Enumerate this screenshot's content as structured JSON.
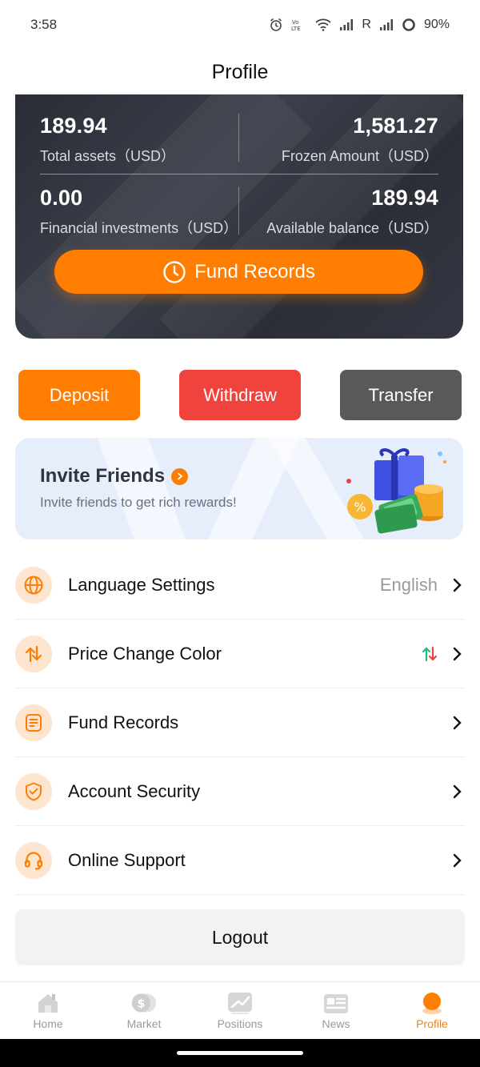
{
  "status_bar": {
    "time": "3:58",
    "carrier_r": "R",
    "battery": "90%"
  },
  "header": {
    "title": "Profile"
  },
  "assets": {
    "total_assets_value": "189.94",
    "total_assets_label": "Total assets（USD）",
    "frozen_value": "1,581.27",
    "frozen_label": "Frozen Amount（USD）",
    "financial_value": "0.00",
    "financial_label": "Financial investments（USD）",
    "available_value": "189.94",
    "available_label": "Available balance（USD）",
    "fund_records_button": "Fund Records"
  },
  "actions": {
    "deposit": "Deposit",
    "withdraw": "Withdraw",
    "transfer": "Transfer"
  },
  "invite": {
    "title": "Invite Friends",
    "subtitle": "Invite friends to get rich rewards!"
  },
  "menu": [
    {
      "label": "Language Settings",
      "value": "English",
      "icon": "globe-icon"
    },
    {
      "label": "Price Change Color",
      "value": "",
      "icon": "swap-arrows-icon"
    },
    {
      "label": "Fund Records",
      "value": "",
      "icon": "document-icon"
    },
    {
      "label": "Account Security",
      "value": "",
      "icon": "shield-check-icon"
    },
    {
      "label": "Online Support",
      "value": "",
      "icon": "headset-icon"
    }
  ],
  "logout": "Logout",
  "tabs": [
    {
      "label": "Home",
      "active": false
    },
    {
      "label": "Market",
      "active": false
    },
    {
      "label": "Positions",
      "active": false
    },
    {
      "label": "News",
      "active": false
    },
    {
      "label": "Profile",
      "active": true
    }
  ],
  "colors": {
    "accent": "#ff7d00",
    "withdraw": "#f0433d",
    "transfer": "#595959",
    "price_up": "#1db980",
    "price_down": "#f0433d"
  }
}
